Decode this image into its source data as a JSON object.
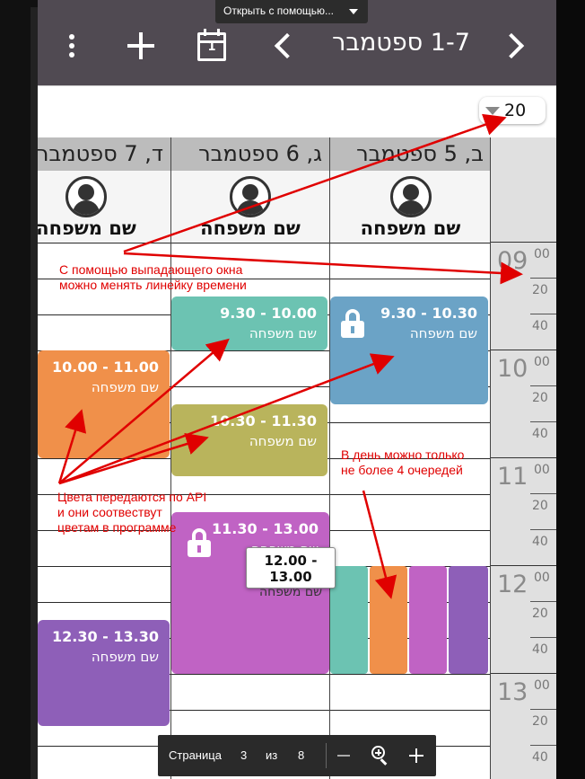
{
  "viewer": {
    "open_with_label": "Открыть с помощью...",
    "pager": {
      "page_label": "Страница",
      "page_current": "3",
      "of_label": "из",
      "page_total": "8"
    }
  },
  "toolbar": {
    "menu_icon": "kebab-icon",
    "add_icon": "plus-icon",
    "today_icon": "calendar-icon",
    "today_day": "1",
    "prev_icon": "chevron-left-icon",
    "next_icon": "chevron-right-icon",
    "range_title": "1-7 ספטמבר"
  },
  "interval_select": {
    "value": "20"
  },
  "days": [
    {
      "header": "ב, 5 ספטמבר",
      "person": "שם משפחה"
    },
    {
      "header": "ג, 6 ספטמבר",
      "person": "שם משפחה"
    },
    {
      "header": "ד, 7 ספטמבר",
      "person": "שם משפחה"
    }
  ],
  "time_axis": [
    {
      "hour": "09",
      "sup": "00",
      "m1": "20",
      "m2": "40"
    },
    {
      "hour": "10",
      "sup": "00",
      "m1": "20",
      "m2": "40"
    },
    {
      "hour": "11",
      "sup": "00",
      "m1": "20",
      "m2": "40"
    },
    {
      "hour": "12",
      "sup": "00",
      "m1": "20",
      "m2": "40"
    },
    {
      "hour": "13",
      "sup": "00",
      "m1": "20",
      "m2": "40"
    }
  ],
  "events": [
    {
      "time": "9.30 - 10.30",
      "name": "שם משפחה",
      "color": "#6ba3c6",
      "locked": true
    },
    {
      "time": "9.30 - 10.00",
      "name": "שם משפחה",
      "color": "#6cc3b2"
    },
    {
      "time": "10.30 - 11.30",
      "name": "שם משפחה",
      "color": "#b9b45c"
    },
    {
      "time": "11.30 - 13.00",
      "name": "שם משפחה",
      "color": "#c063c4",
      "locked": true
    },
    {
      "time": "10.00 - 11.00",
      "name": "שם משפחה",
      "color": "#f0904a"
    },
    {
      "time": "12.30 - 13.30",
      "name": "שם משפחה",
      "color": "#8e5fb8"
    }
  ],
  "stacked_colors": [
    "#6cc3b2",
    "#f0904a",
    "#c063c4",
    "#8e5fb8"
  ],
  "tooltip": {
    "time": "12.00 - 13.00",
    "name": "שם משפחה"
  },
  "annotations": {
    "interval_note_1": "С помощью выпадающего окна",
    "interval_note_2": "можно менять линейку времени",
    "colors_note_1": "Цвета передаются по API",
    "colors_note_2": "и они соотвествут",
    "colors_note_3": "цветам в программе",
    "queue_note_1": "В день можно только",
    "queue_note_2": "не более 4 очередей",
    "color": "#e00000"
  }
}
